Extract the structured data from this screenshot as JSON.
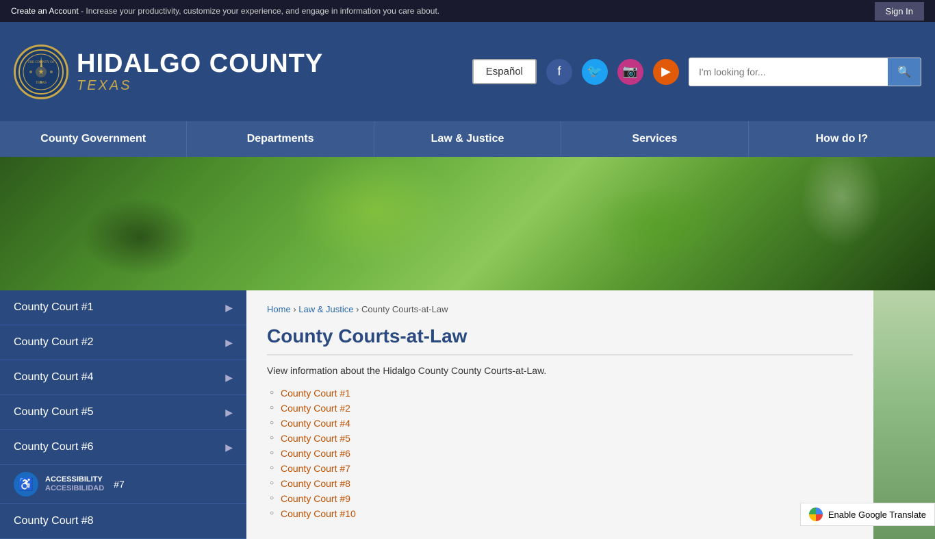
{
  "top_banner": {
    "create_text": "Create an Account",
    "banner_text": " - Increase your productivity, customize your experience, and engage in information you care about.",
    "sign_in_label": "Sign In"
  },
  "header": {
    "county_name": "HIDALGO COUNTY",
    "texas": "TEXAS",
    "espanol_label": "Español",
    "search_placeholder": "I'm looking for..."
  },
  "nav": {
    "items": [
      {
        "label": "County Government"
      },
      {
        "label": "Departments"
      },
      {
        "label": "Law & Justice"
      },
      {
        "label": "Services"
      },
      {
        "label": "How do I?"
      }
    ]
  },
  "breadcrumb": {
    "home": "Home",
    "law_justice": "Law & Justice",
    "current": "County Courts-at-Law"
  },
  "page": {
    "title": "County Courts-at-Law",
    "description": "View information about the Hidalgo County County Courts-at-Law.",
    "courts": [
      "County Court #1",
      "County Court #2",
      "County Court #4",
      "County Court #5",
      "County Court #6",
      "County Court #7",
      "County Court #8",
      "County Court #9",
      "County Court #10"
    ]
  },
  "sidebar": {
    "items": [
      {
        "label": "County Court #1"
      },
      {
        "label": "County Court #2"
      },
      {
        "label": "County Court #4"
      },
      {
        "label": "County Court #5"
      },
      {
        "label": "County Court #6"
      },
      {
        "label": "County Court #7"
      },
      {
        "label": "County Court #8"
      }
    ],
    "accessibility_en": "ACCESSIBILITY",
    "accessibility_es": "ACCESIBILIDAD"
  },
  "google_translate": {
    "label": "Enable Google Translate"
  }
}
